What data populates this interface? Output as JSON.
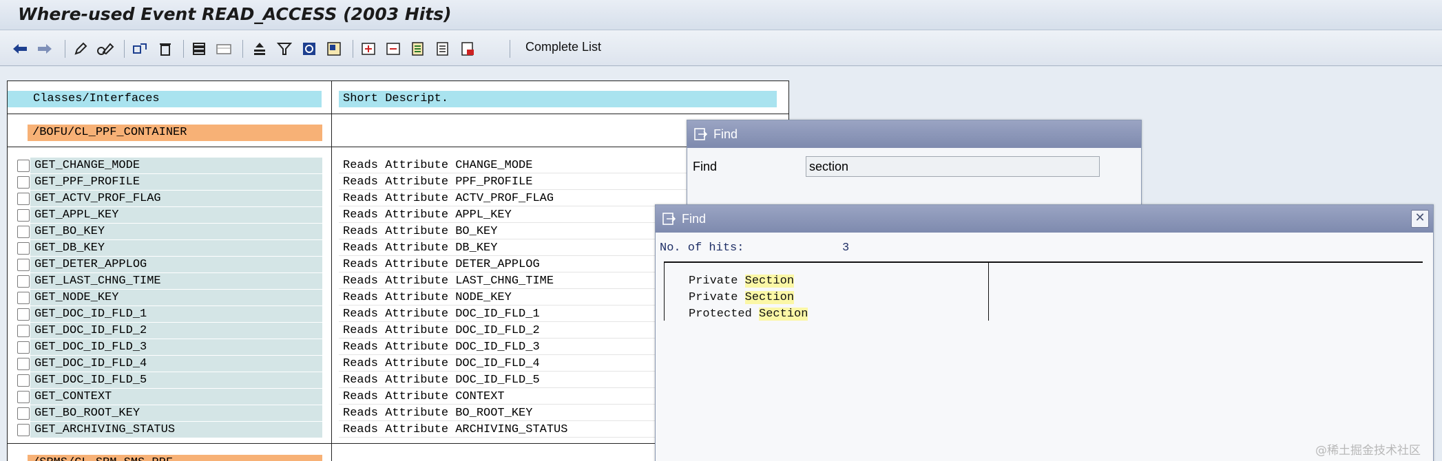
{
  "window": {
    "title": "Where-used Event READ_ACCESS (2003 Hits)"
  },
  "toolbar": {
    "icons": [
      "back-icon",
      "forward-icon",
      "edit-icon",
      "display-change-icon",
      "where-used-icon",
      "delete-icon",
      "select-icon",
      "deselect-icon",
      "sort-ascending-icon",
      "filter-icon",
      "refresh-icon",
      "export-icon",
      "expand-icon",
      "collapse-icon",
      "detail-icon",
      "print-icon",
      "exit-icon"
    ],
    "complete_list_label": "Complete List"
  },
  "list": {
    "header": {
      "col1": "Classes/Interfaces",
      "col2": "Short Descript."
    },
    "class_name": "/BOFU/CL_PPF_CONTAINER",
    "next_class_name": "/SRMS/CL_SRM_SMS_PPF",
    "rows": [
      {
        "name": "GET_CHANGE_MODE",
        "desc": "Reads Attribute CHANGE_MODE"
      },
      {
        "name": "GET_PPF_PROFILE",
        "desc": "Reads Attribute PPF_PROFILE"
      },
      {
        "name": "GET_ACTV_PROF_FLAG",
        "desc": "Reads Attribute ACTV_PROF_FLAG"
      },
      {
        "name": "GET_APPL_KEY",
        "desc": "Reads Attribute APPL_KEY"
      },
      {
        "name": "GET_BO_KEY",
        "desc": "Reads Attribute BO_KEY"
      },
      {
        "name": "GET_DB_KEY",
        "desc": "Reads Attribute DB_KEY"
      },
      {
        "name": "GET_DETER_APPLOG",
        "desc": "Reads Attribute DETER_APPLOG"
      },
      {
        "name": "GET_LAST_CHNG_TIME",
        "desc": "Reads Attribute LAST_CHNG_TIME"
      },
      {
        "name": "GET_NODE_KEY",
        "desc": "Reads Attribute NODE_KEY"
      },
      {
        "name": "GET_DOC_ID_FLD_1",
        "desc": "Reads Attribute DOC_ID_FLD_1"
      },
      {
        "name": "GET_DOC_ID_FLD_2",
        "desc": "Reads Attribute DOC_ID_FLD_2"
      },
      {
        "name": "GET_DOC_ID_FLD_3",
        "desc": "Reads Attribute DOC_ID_FLD_3"
      },
      {
        "name": "GET_DOC_ID_FLD_4",
        "desc": "Reads Attribute DOC_ID_FLD_4"
      },
      {
        "name": "GET_DOC_ID_FLD_5",
        "desc": "Reads Attribute DOC_ID_FLD_5"
      },
      {
        "name": "GET_CONTEXT",
        "desc": "Reads Attribute CONTEXT"
      },
      {
        "name": "GET_BO_ROOT_KEY",
        "desc": "Reads Attribute BO_ROOT_KEY"
      },
      {
        "name": "GET_ARCHIVING_STATUS",
        "desc": "Reads Attribute ARCHIVING_STATUS"
      }
    ]
  },
  "find_dialog": {
    "title": "Find",
    "field_label": "Find",
    "field_value": "section"
  },
  "results_dialog": {
    "title": "Find",
    "close_label": "✕",
    "hits_label": "No. of hits:",
    "hits_value": "3",
    "hits": [
      {
        "prefix": "Private",
        "match": "Section"
      },
      {
        "prefix": "Private",
        "match": "Section"
      },
      {
        "prefix": "Protected",
        "match": "Section"
      }
    ]
  },
  "watermark": "@稀土掘金技术社区",
  "colors": {
    "header_cell": "#a9e3ef",
    "class_cell": "#f7b176",
    "name_cell": "#d4e5e6",
    "dialog_title": "#8a95b8",
    "highlight": "#fbf7a6"
  }
}
